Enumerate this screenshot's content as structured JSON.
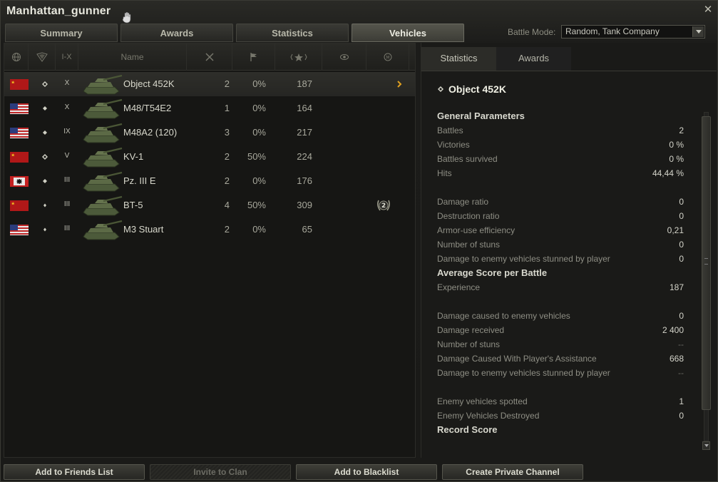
{
  "window": {
    "title": "Manhattan_gunner"
  },
  "tabs": [
    {
      "label": "Summary",
      "active": false
    },
    {
      "label": "Awards",
      "active": false
    },
    {
      "label": "Statistics",
      "active": false
    },
    {
      "label": "Vehicles",
      "active": true
    }
  ],
  "battle_mode": {
    "label": "Battle Mode:",
    "value": "Random, Tank Company"
  },
  "columns": {
    "nation_icon": "globe-icon",
    "class_icon": "vehicle-class-icon",
    "tier": "I-X",
    "name": "Name",
    "battles_icon": "crossed-swords-icon",
    "winrate_icon": "flag-icon",
    "xp_icon": "star-icon",
    "camo_icon": "eye-icon",
    "mastery_icon": "mastery-badge-icon"
  },
  "vehicles": [
    {
      "nation": "ussr",
      "class": "heavy",
      "tier": "X",
      "name": "Object 452K",
      "battles": "2",
      "winrate": "0%",
      "avg_xp": "187",
      "mastery": "",
      "selected": true
    },
    {
      "nation": "usa",
      "class": "medium",
      "tier": "X",
      "name": "M48/T54E2",
      "battles": "1",
      "winrate": "0%",
      "avg_xp": "164",
      "mastery": ""
    },
    {
      "nation": "usa",
      "class": "medium",
      "tier": "IX",
      "name": "M48A2 (120)",
      "battles": "3",
      "winrate": "0%",
      "avg_xp": "217",
      "mastery": ""
    },
    {
      "nation": "ussr",
      "class": "heavy",
      "tier": "V",
      "name": "KV-1",
      "battles": "2",
      "winrate": "50%",
      "avg_xp": "224",
      "mastery": ""
    },
    {
      "nation": "germany",
      "class": "medium",
      "tier": "III",
      "name": "Pz. III E",
      "battles": "2",
      "winrate": "0%",
      "avg_xp": "176",
      "mastery": ""
    },
    {
      "nation": "ussr",
      "class": "light",
      "tier": "III",
      "name": "BT-5",
      "battles": "4",
      "winrate": "50%",
      "avg_xp": "309",
      "mastery": "2"
    },
    {
      "nation": "usa",
      "class": "light",
      "tier": "III",
      "name": "M3 Stuart",
      "battles": "2",
      "winrate": "0%",
      "avg_xp": "65",
      "mastery": ""
    }
  ],
  "detail": {
    "tabs": [
      {
        "label": "Statistics",
        "active": true
      },
      {
        "label": "Awards",
        "active": false
      }
    ],
    "vehicle_name": "Object 452K",
    "general_title": "General Parameters",
    "general": [
      {
        "label": "Battles",
        "value": "2"
      },
      {
        "label": "Victories",
        "value": "0 %"
      },
      {
        "label": "Battles survived",
        "value": "0 %"
      },
      {
        "label": "Hits",
        "value": "44,44 %"
      }
    ],
    "ratios": [
      {
        "label": "Damage ratio",
        "value": "0"
      },
      {
        "label": "Destruction ratio",
        "value": "0"
      },
      {
        "label": "Armor-use efficiency",
        "value": "0,21"
      },
      {
        "label": "Number of stuns",
        "value": "0"
      },
      {
        "label": "Damage to enemy vehicles stunned by player",
        "value": "0"
      }
    ],
    "average_title": "Average Score per Battle",
    "average_xp": [
      {
        "label": "Experience",
        "value": "187"
      }
    ],
    "average_damage": [
      {
        "label": "Damage caused to enemy vehicles",
        "value": "0"
      },
      {
        "label": "Damage received",
        "value": "2 400"
      },
      {
        "label": "Number of stuns",
        "value": "--"
      },
      {
        "label": "Damage Caused With Player's Assistance",
        "value": "668"
      },
      {
        "label": "Damage to enemy vehicles stunned by player",
        "value": "--"
      }
    ],
    "average_kills": [
      {
        "label": "Enemy vehicles spotted",
        "value": "1"
      },
      {
        "label": "Enemy Vehicles Destroyed",
        "value": "0"
      }
    ],
    "record_title": "Record Score"
  },
  "buttons": [
    {
      "label": "Add to Friends List",
      "enabled": true
    },
    {
      "label": "Invite to Clan",
      "enabled": false
    },
    {
      "label": "Add to Blacklist",
      "enabled": true
    },
    {
      "label": "Create Private Channel",
      "enabled": true
    }
  ],
  "colors": {
    "accent_chevron": "#e0a020",
    "selected_row": "#2e2e2a"
  }
}
